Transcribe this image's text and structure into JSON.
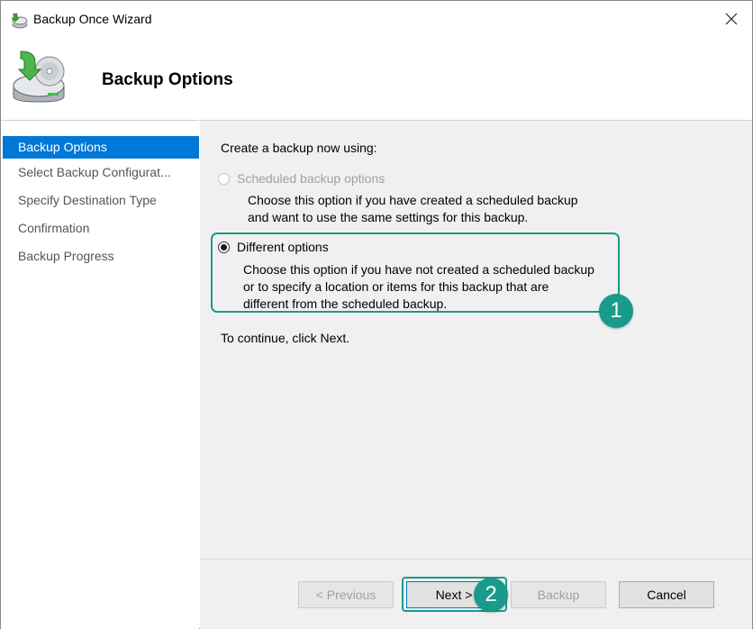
{
  "window": {
    "title": "Backup Once Wizard",
    "close_symbol": "✕",
    "icon": "backup-wizard-icon"
  },
  "header": {
    "title": "Backup Options",
    "icon": "backup-disk-icon"
  },
  "sidebar": {
    "items": [
      {
        "label": "Backup Options",
        "active": true
      },
      {
        "label": "Select Backup Configurat..."
      },
      {
        "label": "Specify Destination Type"
      },
      {
        "label": "Confirmation"
      },
      {
        "label": "Backup Progress"
      }
    ]
  },
  "main": {
    "prompt": "Create a backup now using:",
    "option_scheduled": {
      "label": "Scheduled backup options",
      "enabled": false,
      "checked": false,
      "description_line1": "Choose this option if you have created a scheduled backup",
      "description_line2": "and want to use the same settings for this backup."
    },
    "option_different": {
      "label": "Different options",
      "enabled": true,
      "checked": true,
      "description_line1": "Choose this option if you have not created a scheduled backup",
      "description_line2": "or to specify a location or items for this backup that are",
      "description_line3": "different from the scheduled backup."
    },
    "continue_text": "To continue, click Next."
  },
  "annotations": {
    "badge1": "1",
    "badge2": "2",
    "color": "#1a9a8a"
  },
  "buttons": {
    "previous": "< Previous",
    "next": "Next >",
    "backup": "Backup",
    "cancel": "Cancel"
  },
  "colors": {
    "selection": "#0078d7",
    "panel": "#f0f0f0"
  }
}
